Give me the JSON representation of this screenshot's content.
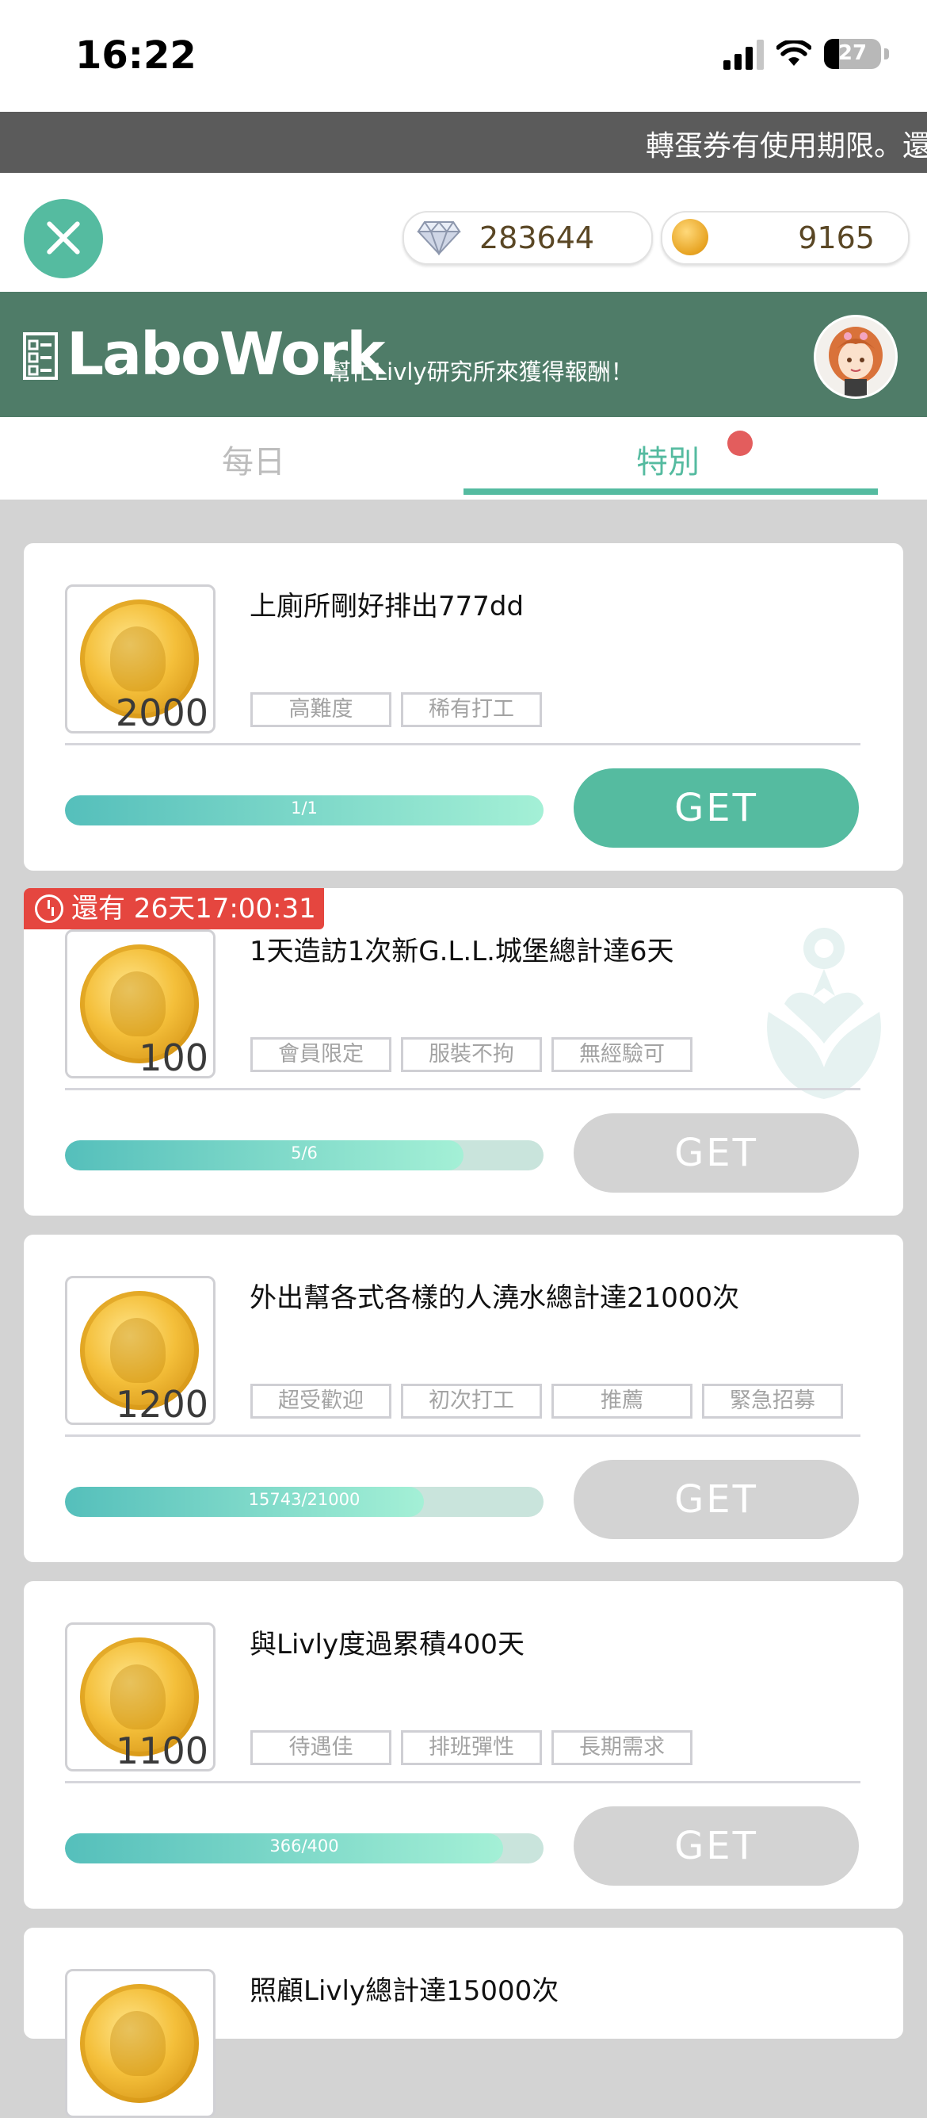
{
  "status_bar": {
    "time": "16:22",
    "battery": "27",
    "battery_level": 0.27,
    "icons": [
      "signal-icon",
      "wifi-icon",
      "battery-icon"
    ]
  },
  "ticker": {
    "text": "轉蛋券有使用期限。還"
  },
  "currency": {
    "gems": "283644",
    "coins": "9165",
    "gem_icon": "diamond-icon",
    "coin_icon": "coin-icon"
  },
  "banner": {
    "title": "LaboWork",
    "subtitle": "幫忙Livly研究所來獲得報酬！",
    "avatar": "avatar"
  },
  "tabs": [
    {
      "label": "每日",
      "active": false
    },
    {
      "label": "特別",
      "active": true,
      "badge_dot": true
    }
  ],
  "tasks": [
    {
      "reward": "2000",
      "title": "上廁所剛好排出777dd",
      "tags": [
        "高難度",
        "稀有打工"
      ],
      "progress_text": "1/1",
      "progress": 1.0,
      "button": "GET",
      "button_active": true
    },
    {
      "timer": "還有 26天17:00:31",
      "reward": "100",
      "title": "1天造訪1次新G.L.L.城堡總計達6天",
      "tags": [
        "會員限定",
        "服裝不拘",
        "無經驗可"
      ],
      "progress_text": "5/6",
      "progress": 0.833,
      "button": "GET",
      "button_active": false
    },
    {
      "reward": "1200",
      "title": "外出幫各式各樣的人澆水總計達21000次",
      "tags": [
        "超受歡迎",
        "初次打工",
        "推薦",
        "緊急招募"
      ],
      "progress_text": "15743/21000",
      "progress": 0.75,
      "button": "GET",
      "button_active": false
    },
    {
      "reward": "1100",
      "title": "與Livly度過累積400天",
      "tags": [
        "待遇佳",
        "排班彈性",
        "長期需求"
      ],
      "progress_text": "366/400",
      "progress": 0.915,
      "button": "GET",
      "button_active": false
    },
    {
      "reward": "",
      "title": "照顧Livly總計達15000次",
      "tags": []
    }
  ],
  "colors": {
    "accent": "#55bba0",
    "banner": "#4f7c68",
    "timer": "#e5463f",
    "inactive": "#d3d3d3"
  }
}
